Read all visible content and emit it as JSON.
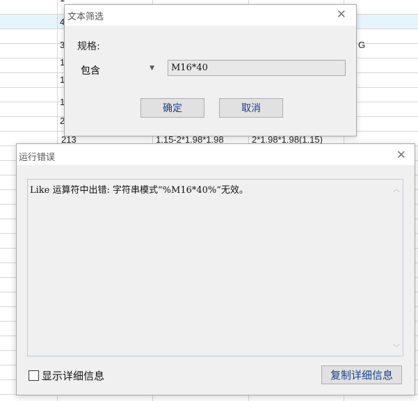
{
  "background_grid": {
    "cells": [
      {
        "text": "1"
      },
      {
        "text": "4"
      },
      {
        "text": "3"
      },
      {
        "text": "1"
      },
      {
        "text": "1"
      },
      {
        "text": "1"
      },
      {
        "text": "2"
      },
      {
        "text": "213"
      },
      {
        "text": "1.15-2*1.98*1.98"
      },
      {
        "text": "2*1.98*1.98(1.15)"
      },
      {
        "text": "G"
      }
    ]
  },
  "filter_dialog": {
    "title": "文本筛选",
    "field_label": "规格:",
    "operator_selected": "包含",
    "value": "M16*40",
    "ok_label": "确定",
    "cancel_label": "取消"
  },
  "error_dialog": {
    "title": "运行错误",
    "message": "Like 运算符中出错: 字符串模式“%M16*40%”无效。",
    "show_details_label": "显示详细信息",
    "show_details_checked": false,
    "copy_details_label": "复制详细信息"
  }
}
